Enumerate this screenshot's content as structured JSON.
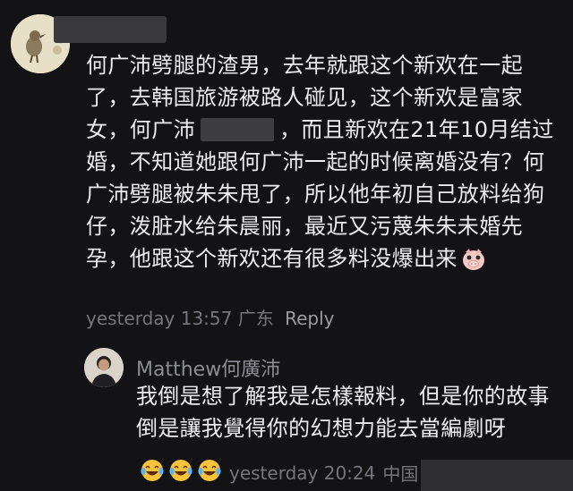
{
  "comment": {
    "text_before_redaction": "何广沛劈腿的渣男，去年就跟这个新欢在一起了，去韩国旅游被路人碰见，这个新欢是富家女，何广沛",
    "text_after_redaction": "，而且新欢在21年10月结过婚，不知道她跟何广沛一起的时候离婚没有？何广沛劈腿被朱朱甩了，所以他年初自己放料给狗仔，泼脏水给朱晨丽，最近又污蔑朱朱未婚先孕，他跟这个新欢还有很多料没爆出来",
    "time": "yesterday 13:57",
    "location": "广东",
    "reply_label": "Reply"
  },
  "reply": {
    "username": "Matthew何廣沛",
    "text": "我倒是想了解我是怎樣報料，但是你的故事倒是讓我覺得你的幻想力能去當編劇呀",
    "emoji_count": 3,
    "time": "yesterday 20:24",
    "location": "中国"
  },
  "icons": {
    "comment_end_emoji": "pig-face-icon",
    "reply_emoji": "laughing-tears-icon"
  },
  "colors": {
    "background": "#131316",
    "text": "#ececef",
    "meta": "#75757c"
  }
}
